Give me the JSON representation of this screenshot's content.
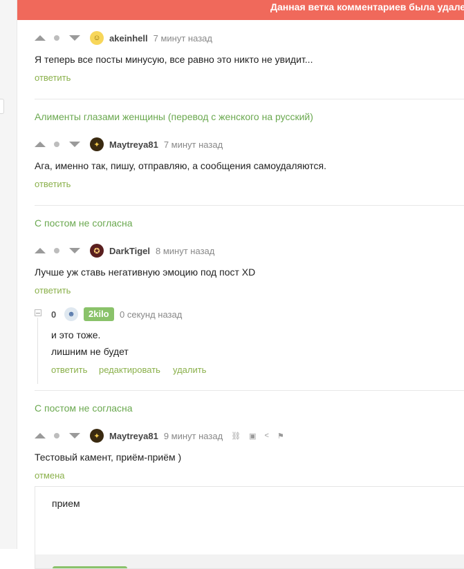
{
  "banner": {
    "text": "Данная ветка комментариев была удалена"
  },
  "actions": {
    "reply": "ответить",
    "edit": "редактировать",
    "delete": "удалить",
    "cancel": "отмена"
  },
  "comments": [
    {
      "author": "akeinhell",
      "time": "7 минут назад",
      "text": "Я теперь все посты минусую, все равно это никто не увидит..."
    },
    {
      "story": "Алименты глазами женщины (перевод с женского на русский)",
      "author": "Maytreya81",
      "time": "7 минут назад",
      "text": "Ага, именно так, пишу, отправляю, а сообщения самоудаляются."
    },
    {
      "story": "С постом не согласна",
      "author": "DarkTigel",
      "time": "8 минут назад",
      "text": "Лучше уж ставь негативную эмоцию под пост XD"
    },
    {
      "story": "С постом не согласна",
      "author": "Maytreya81",
      "time": "9 минут назад",
      "text": "Тестовый камент, приём-приём )"
    }
  ],
  "own_comment": {
    "rating": "0",
    "author": "2kilo",
    "time": "0 секунд назад",
    "lines": [
      "и это тоже.",
      "лишним не будет"
    ]
  },
  "reply_input": {
    "value": "прием"
  },
  "icons": [
    "collapse-icon",
    "link-icon",
    "save-icon",
    "share-icon",
    "flag-icon"
  ],
  "colors": {
    "banner": "#f0695b",
    "link": "#8ab04a",
    "story": "#6aa84f",
    "own_badge": "#8ac26a"
  }
}
